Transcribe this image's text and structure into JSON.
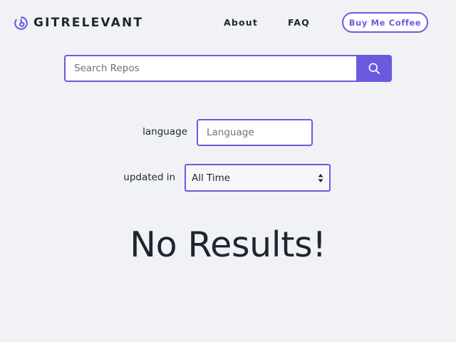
{
  "header": {
    "logo_text": "GITRELEVANT",
    "nav": {
      "about": "About",
      "faq": "FAQ"
    },
    "coffee_label": "Buy Me Coffee"
  },
  "search": {
    "placeholder": "Search Repos",
    "value": "",
    "button_icon": "search-icon"
  },
  "filters": {
    "language": {
      "label": "language",
      "placeholder": "Language",
      "value": ""
    },
    "updated": {
      "label": "updated in",
      "selected": "All Time"
    }
  },
  "results": {
    "message": "No Results!"
  },
  "colors": {
    "accent": "#6b5ae0",
    "background": "#f0f2f6",
    "text": "#1f2530"
  }
}
